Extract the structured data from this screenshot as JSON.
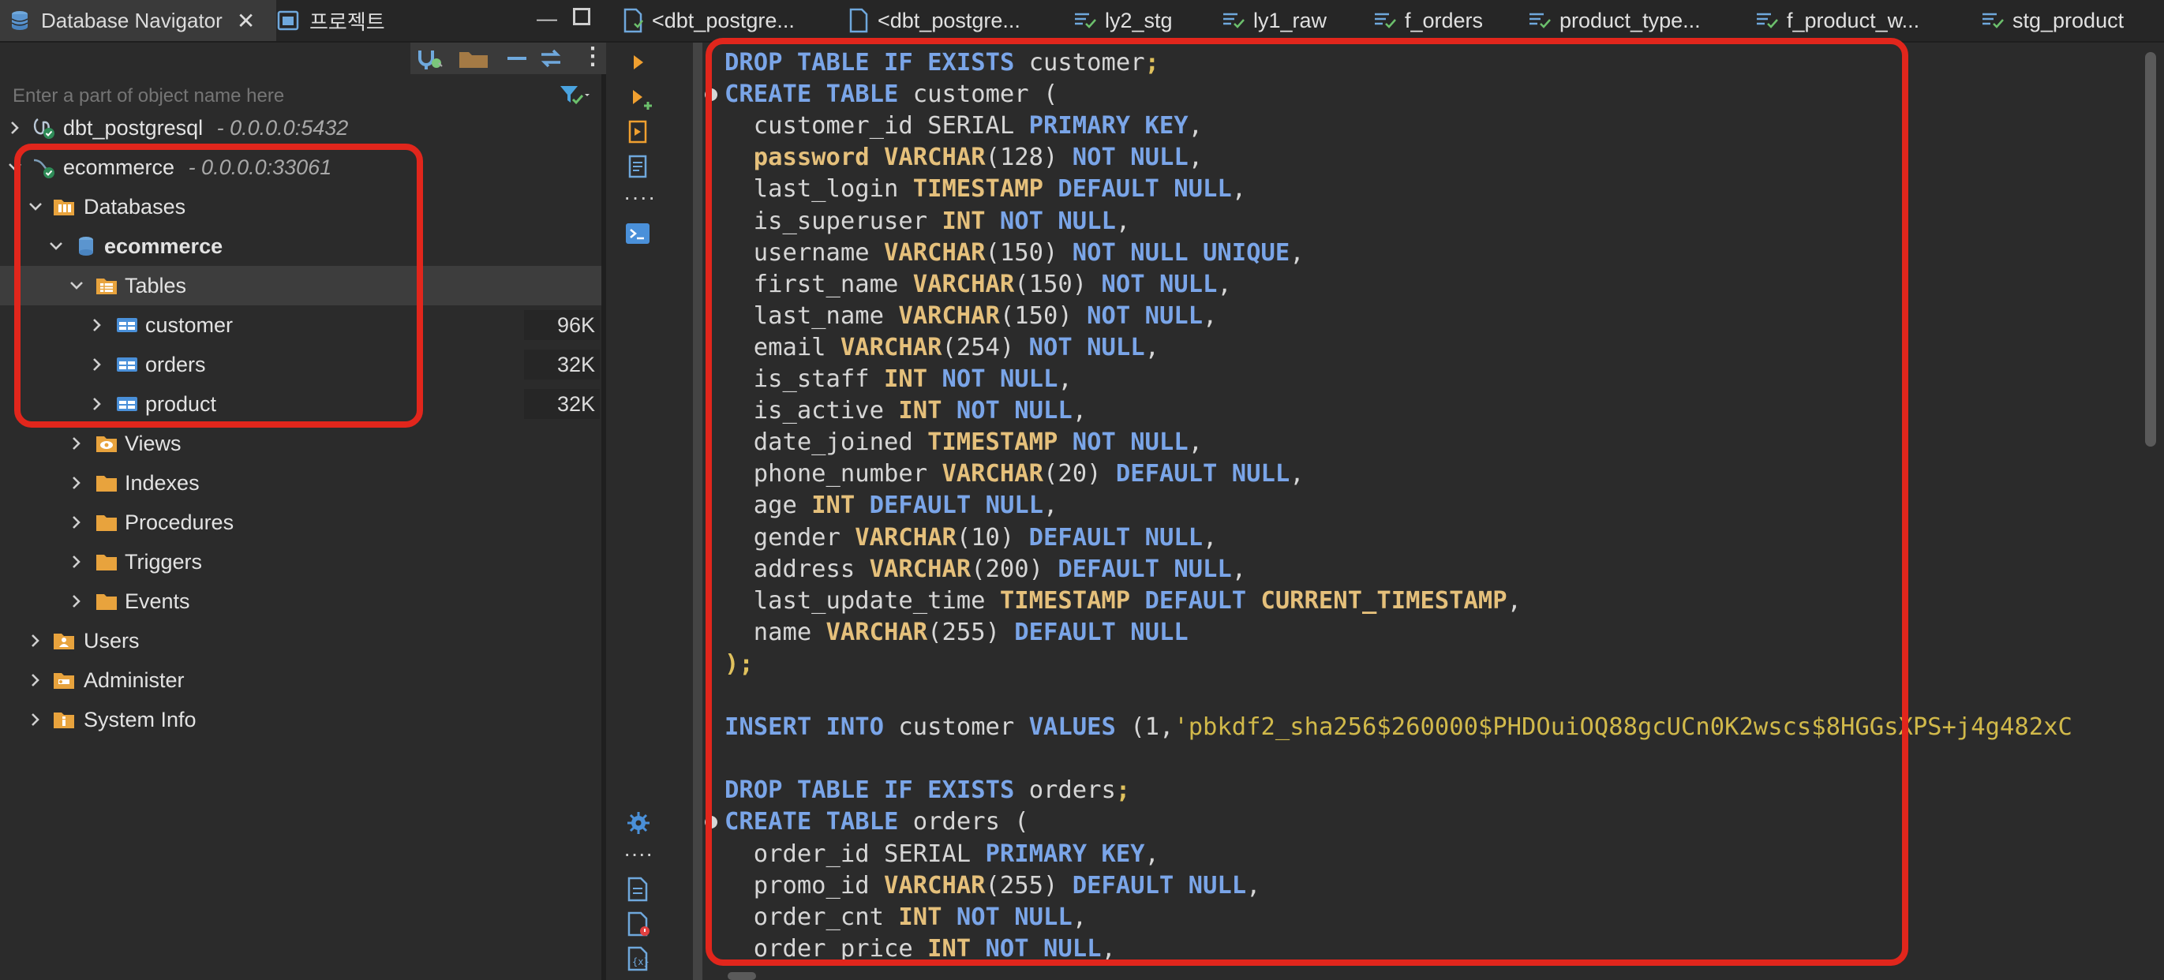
{
  "left_panel": {
    "tabs": [
      {
        "label": "Database Navigator",
        "icon": "database-stack-icon"
      },
      {
        "label": "프로젝트",
        "icon": "project-icon"
      }
    ],
    "filter_placeholder": "Enter a part of object name here",
    "tree": [
      {
        "label": "dbt_postgresql",
        "sub": "- 0.0.0.0:5432",
        "icon": "postgres-connection-icon",
        "expanded": false
      },
      {
        "label": "ecommerce",
        "sub": "- 0.0.0.0:33061",
        "icon": "mysql-connection-icon",
        "expanded": true
      },
      {
        "label": "Databases",
        "icon": "folder-databases-icon",
        "expanded": true
      },
      {
        "label": "ecommerce",
        "icon": "database-icon",
        "expanded": true
      },
      {
        "label": "Tables",
        "icon": "tables-folder-icon",
        "expanded": true
      },
      {
        "label": "customer",
        "icon": "table-icon",
        "size": "96K"
      },
      {
        "label": "orders",
        "icon": "table-icon",
        "size": "32K"
      },
      {
        "label": "product",
        "icon": "table-icon",
        "size": "32K"
      },
      {
        "label": "Views",
        "icon": "views-folder-icon"
      },
      {
        "label": "Indexes",
        "icon": "folder-icon"
      },
      {
        "label": "Procedures",
        "icon": "folder-icon"
      },
      {
        "label": "Triggers",
        "icon": "folder-icon"
      },
      {
        "label": "Events",
        "icon": "folder-icon"
      },
      {
        "label": "Users",
        "icon": "users-folder-icon"
      },
      {
        "label": "Administer",
        "icon": "administer-folder-icon"
      },
      {
        "label": "System Info",
        "icon": "system-info-folder-icon"
      }
    ]
  },
  "editor_tabs": [
    {
      "label": "<dbt_postgre...",
      "icon": "sql-script-icon"
    },
    {
      "label": "<dbt_postgre...",
      "icon": "sql-script-icon"
    },
    {
      "label": "ly2_stg",
      "icon": "sql-file-icon"
    },
    {
      "label": "ly1_raw",
      "icon": "sql-file-icon"
    },
    {
      "label": "f_orders",
      "icon": "sql-file-icon"
    },
    {
      "label": "product_type...",
      "icon": "sql-file-icon"
    },
    {
      "label": "f_product_w...",
      "icon": "sql-file-icon"
    },
    {
      "label": "stg_product",
      "icon": "sql-file-icon"
    }
  ],
  "editor": {
    "lines": [
      "DROP TABLE IF EXISTS customer;",
      "CREATE TABLE customer (",
      "  customer_id SERIAL PRIMARY KEY,",
      "  password VARCHAR(128) NOT NULL,",
      "  last_login TIMESTAMP DEFAULT NULL,",
      "  is_superuser INT NOT NULL,",
      "  username VARCHAR(150) NOT NULL UNIQUE,",
      "  first_name VARCHAR(150) NOT NULL,",
      "  last_name VARCHAR(150) NOT NULL,",
      "  email VARCHAR(254) NOT NULL,",
      "  is_staff INT NOT NULL,",
      "  is_active INT NOT NULL,",
      "  date_joined TIMESTAMP NOT NULL,",
      "  phone_number VARCHAR(20) DEFAULT NULL,",
      "  age INT DEFAULT NULL,",
      "  gender VARCHAR(10) DEFAULT NULL,",
      "  address VARCHAR(200) DEFAULT NULL,",
      "  last_update_time TIMESTAMP DEFAULT CURRENT_TIMESTAMP,",
      "  name VARCHAR(255) DEFAULT NULL",
      ");",
      "",
      "INSERT INTO customer VALUES (1,'pbkdf2_sha256$260000$PHDOuiOQ88gcUCn0K2wscs$8HGGsXPS+j4g482xC",
      "",
      "DROP TABLE IF EXISTS orders;",
      "CREATE TABLE orders (",
      "  order_id SERIAL PRIMARY KEY,",
      "  promo_id VARCHAR(255) DEFAULT NULL,",
      "  order_cnt INT NOT NULL,",
      "  order_price INT NOT NULL,"
    ]
  },
  "colors": {
    "highlight_box": "#e1261c",
    "keyword": "#7aa5e8",
    "type": "#e5c07b",
    "background": "#2b2b2b"
  }
}
